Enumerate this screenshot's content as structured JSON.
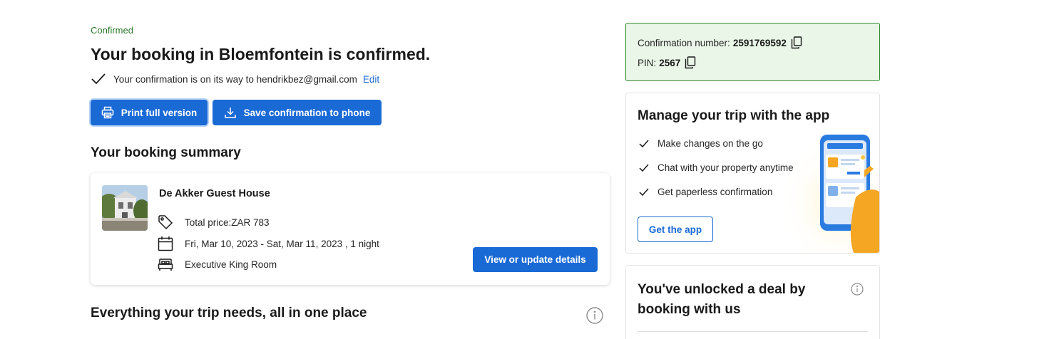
{
  "header": {
    "status_label": "Confirmed",
    "title": "Your booking in Bloemfontein is confirmed.",
    "email_text": "Your confirmation is on its way to hendrikbez@gmail.com",
    "edit_label": "Edit"
  },
  "actions": {
    "print_label": "Print full version",
    "save_label": "Save confirmation to phone"
  },
  "summary": {
    "section_title": "Your booking summary",
    "hotel_name": "De Akker Guest House",
    "price_label": "Total price:",
    "price_value": "ZAR 783",
    "dates": "Fri, Mar 10, 2023 - Sat, Mar 11, 2023 , 1 night",
    "room": "Executive King Room",
    "view_button": "View or update details"
  },
  "trip": {
    "section_title": "Everything your trip needs, all in one place"
  },
  "confirmation": {
    "number_label": "Confirmation number:",
    "number_value": "2591769592",
    "pin_label": "PIN:",
    "pin_value": "2567"
  },
  "app_promo": {
    "title": "Manage your trip with the app",
    "features": [
      "Make changes on the go",
      "Chat with your property anytime",
      "Get paperless confirmation"
    ],
    "button": "Get the app"
  },
  "deal": {
    "title": "You've unlocked a deal by booking with us"
  },
  "colors": {
    "accent": "#1a6ad6",
    "success_border": "#2b8a2b",
    "success_bg": "#eaf7e8",
    "status_text": "#2a7a2a"
  },
  "icons": {
    "check": "check-icon",
    "print": "printer-icon",
    "download": "download-icon",
    "price": "tag-icon",
    "dates": "calendar-icon",
    "room": "bed-icon",
    "copy": "copy-icon",
    "info": "info-icon"
  }
}
